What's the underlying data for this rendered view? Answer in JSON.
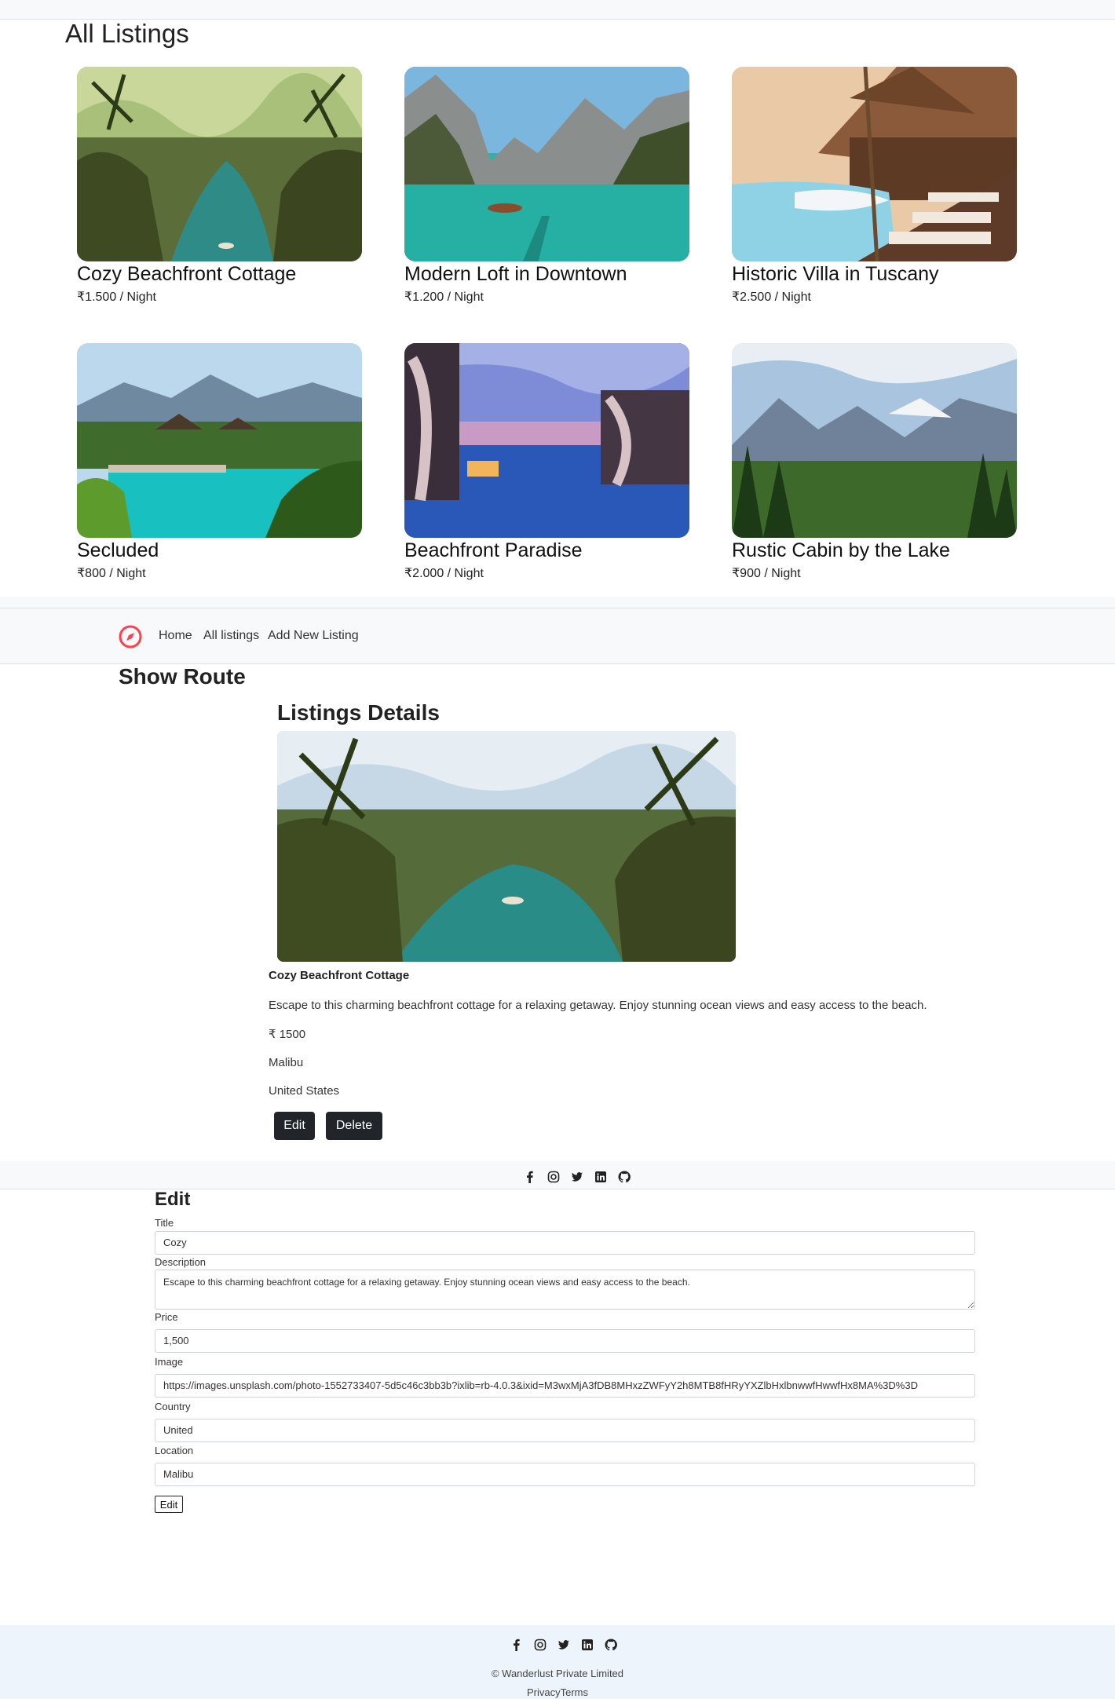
{
  "all_listings": {
    "title": "All Listings",
    "cards": [
      {
        "title": "Cozy Beachfront Cottage",
        "price": "₹1.500 / Night",
        "image": "tropical-river"
      },
      {
        "title": "Modern Loft in Downtown",
        "price": "₹1.200 / Night",
        "image": "mountain-lake"
      },
      {
        "title": "Historic Villa in Tuscany",
        "price": "₹2.500 / Night",
        "image": "villa-pool"
      },
      {
        "title": "Secluded",
        "price": "₹800 / Night",
        "image": "resort-pool"
      },
      {
        "title": "Beachfront Paradise",
        "price": "₹2.000 / Night",
        "image": "beach-cabanas"
      },
      {
        "title": "Rustic Cabin by the Lake",
        "price": "₹900 / Night",
        "image": "mountain-valley"
      }
    ]
  },
  "navbar": {
    "logo_icon": "compass-icon",
    "brand_color": "#fe424d",
    "links": [
      "Home",
      "All listings",
      "Add New Listing"
    ]
  },
  "show": {
    "route_heading": "Show Route",
    "title": "Listings Details",
    "name": "Cozy Beachfront Cottage",
    "description": "Escape to this charming beachfront cottage for a relaxing getaway. Enjoy stunning ocean views and easy access to the beach.",
    "price": "₹ 1500",
    "location": "Malibu",
    "country": "United States",
    "edit_label": "Edit",
    "delete_label": "Delete"
  },
  "social_icons": [
    "facebook-icon",
    "instagram-icon",
    "twitter-icon",
    "linkedin-icon",
    "github-icon"
  ],
  "edit_form": {
    "heading": "Edit",
    "title_label": "Title",
    "title_value": "Cozy",
    "description_label": "Description",
    "description_value": "Escape to this charming beachfront cottage for a relaxing getaway. Enjoy stunning ocean views and easy access to the beach.",
    "price_label": "Price",
    "price_value": "1,500",
    "image_label": "Image",
    "image_value": "https://images.unsplash.com/photo-1552733407-5d5c46c3bb3b?ixlib=rb-4.0.3&ixid=M3wxMjA3fDB8MHxzZWFyY2h8MTB8fHRyYXZlbHxlbnwwfHwwfHx8MA%3D%3D",
    "country_label": "Country",
    "country_value": "United",
    "location_label": "Location",
    "location_value": "Malibu",
    "submit_label": "Edit"
  },
  "footer": {
    "copyright": "© Wanderlust Private Limited",
    "privacy": "Privacy",
    "terms": "Terms"
  }
}
